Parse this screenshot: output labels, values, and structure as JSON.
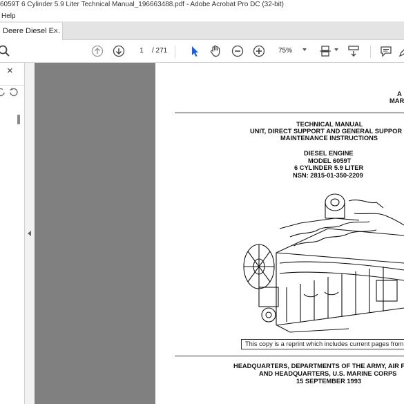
{
  "window": {
    "title": "6059T 6 Cylinder 5.9 Liter Technical Manual_196663488.pdf - Adobe Acrobat Pro DC (32-bit)"
  },
  "menubar": {
    "help": "Help"
  },
  "tabs": [
    {
      "label": "Deere Diesel E...",
      "close": "×"
    }
  ],
  "toolbar": {
    "page_current": "1",
    "page_total": "/ 271",
    "zoom": "75%",
    "icons": [
      "search-icon",
      "page-up-icon",
      "page-down-icon",
      "select-cursor-icon",
      "hand-tool-icon",
      "zoom-out-icon",
      "zoom-in-icon",
      "page-fit-icon",
      "scroll-mode-icon",
      "comment-icon",
      "pen-icon"
    ]
  },
  "left_panel": {
    "close": "×"
  },
  "document": {
    "top_right_1": "A",
    "top_right_2": "MAR",
    "heading_1": "TECHNICAL MANUAL",
    "heading_2": "UNIT, DIRECT SUPPORT AND GENERAL SUPPOR",
    "heading_3": "MAINTENANCE INSTRUCTIONS",
    "engine_1": "DIESEL ENGINE",
    "engine_2": "MODEL 6059T",
    "engine_3": "6 CYLINDER 5.9 LITER",
    "engine_4": "NSN: 2815-01-350-2209",
    "reprint": "This copy is a reprint which includes current pages from",
    "footer_1": "HEADQUARTERS, DEPARTMENTS OF THE ARMY, AIR F",
    "footer_2": "AND HEADQUARTERS, U.S.  MARINE CORPS",
    "footer_3": "15 SEPTEMBER 1993"
  },
  "colors": {
    "canvas": "#808080",
    "tabbar": "#e4e4e4",
    "cursor_blue": "#1a5fd6"
  }
}
